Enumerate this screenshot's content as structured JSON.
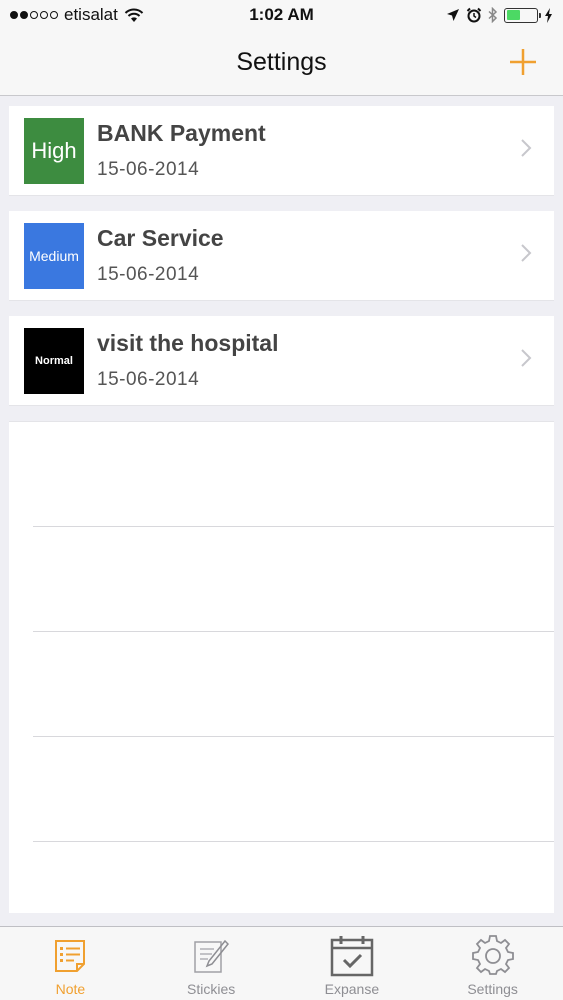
{
  "status_bar": {
    "carrier": "etisalat",
    "time": "1:02 AM",
    "signal_bars": 2,
    "battery_level": 0.45
  },
  "nav": {
    "title": "Settings",
    "add_icon": "plus-icon"
  },
  "notes": [
    {
      "title": "BANK Payment",
      "date": "15-06-2014",
      "priority": "High",
      "priority_color": "#3d8c40"
    },
    {
      "title": "Car Service",
      "date": "15-06-2014",
      "priority": "Medium",
      "priority_color": "#3a78e0"
    },
    {
      "title": "visit the hospital",
      "date": "15-06-2014",
      "priority": "Normal",
      "priority_color": "#000000"
    }
  ],
  "tabs": [
    {
      "label": "Note",
      "icon": "note-icon",
      "active": true
    },
    {
      "label": "Stickies",
      "icon": "pencil-icon",
      "active": false
    },
    {
      "label": "Expanse",
      "icon": "calendar-check-icon",
      "active": false
    },
    {
      "label": "Settings",
      "icon": "gear-icon",
      "active": false
    }
  ],
  "colors": {
    "accent": "#f0a030",
    "inactive_tab": "#8e8e93"
  }
}
